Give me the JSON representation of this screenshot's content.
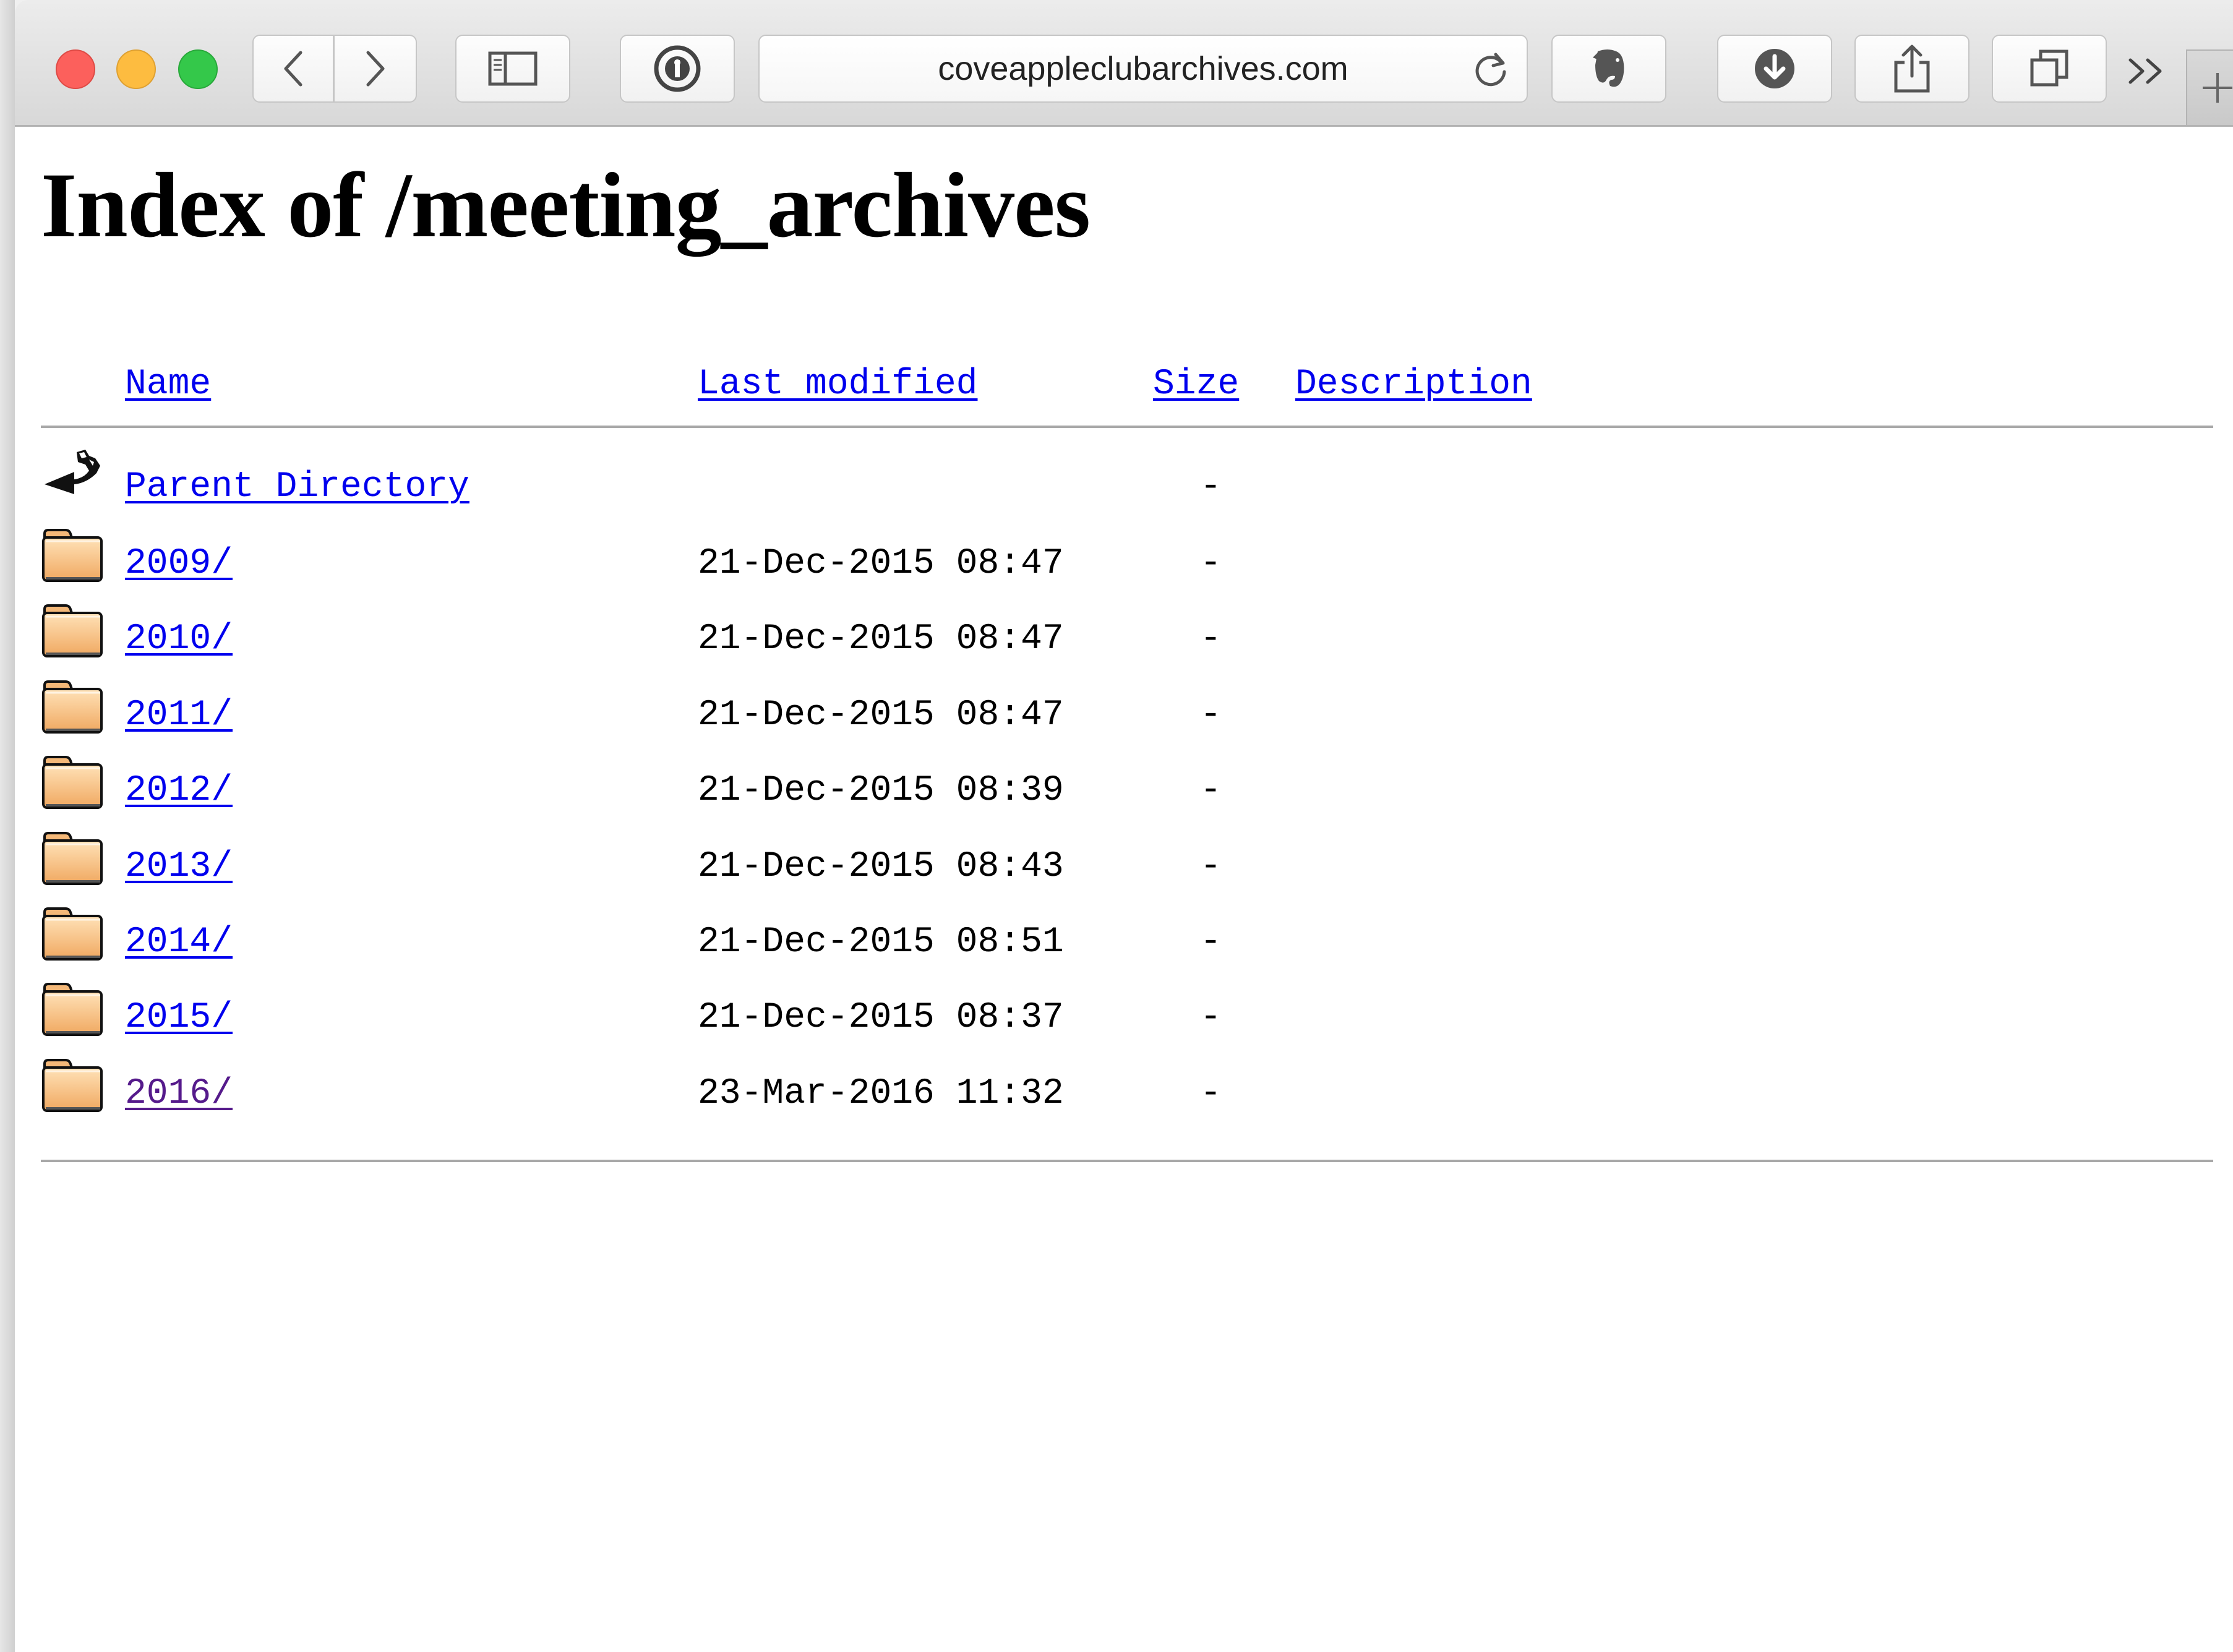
{
  "browser": {
    "url": "coveappleclubarchives.com"
  },
  "page": {
    "title": "Index of /meeting_archives",
    "columns": {
      "name": "Name",
      "last_modified": "Last modified",
      "size": "Size",
      "description": "Description"
    },
    "parent": {
      "label": "Parent Directory",
      "size": "-",
      "icon": "back-arrow-icon"
    },
    "entries": [
      {
        "name": "2009/",
        "modified": "21-Dec-2015 08:47",
        "size": "-",
        "icon": "folder-icon",
        "visited": false
      },
      {
        "name": "2010/",
        "modified": "21-Dec-2015 08:47",
        "size": "-",
        "icon": "folder-icon",
        "visited": false
      },
      {
        "name": "2011/",
        "modified": "21-Dec-2015 08:47",
        "size": "-",
        "icon": "folder-icon",
        "visited": false
      },
      {
        "name": "2012/",
        "modified": "21-Dec-2015 08:39",
        "size": "-",
        "icon": "folder-icon",
        "visited": false
      },
      {
        "name": "2013/",
        "modified": "21-Dec-2015 08:43",
        "size": "-",
        "icon": "folder-icon",
        "visited": false
      },
      {
        "name": "2014/",
        "modified": "21-Dec-2015 08:51",
        "size": "-",
        "icon": "folder-icon",
        "visited": false
      },
      {
        "name": "2015/",
        "modified": "21-Dec-2015 08:37",
        "size": "-",
        "icon": "folder-icon",
        "visited": false
      },
      {
        "name": "2016/",
        "modified": "23-Mar-2016 11:32",
        "size": "-",
        "icon": "folder-icon",
        "visited": true
      }
    ]
  },
  "colors": {
    "link": "#0000ee",
    "visited_link": "#551a8b",
    "close": "#fc605c",
    "minimize": "#fdbc40",
    "maximize": "#34c84a"
  }
}
